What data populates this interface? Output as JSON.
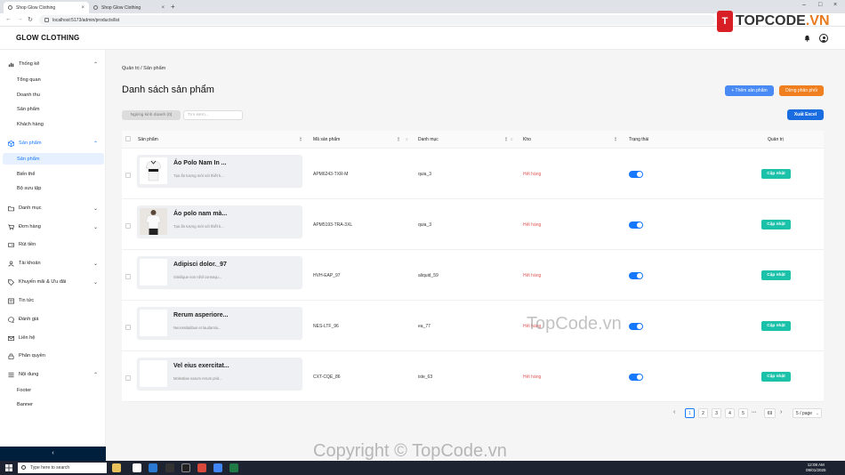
{
  "browser": {
    "tabs": [
      {
        "label": "Shop Glow Clothing",
        "active": true
      },
      {
        "label": "Shop Glow Clothing",
        "active": false
      }
    ],
    "url": "localhost:5173/admin/products/list"
  },
  "header": {
    "brand": "GLOW CLOTHING"
  },
  "sidebar": {
    "items": [
      {
        "label": "Thống kê",
        "icon": "chart-icon",
        "expanded": true
      },
      {
        "label": "Sản phẩm",
        "icon": "cube-icon",
        "expanded": true,
        "active": true
      },
      {
        "label": "Danh mục",
        "icon": "folder-icon"
      },
      {
        "label": "Đơn hàng",
        "icon": "cart-icon"
      },
      {
        "label": "Rút tiền",
        "icon": "wallet-icon"
      },
      {
        "label": "Tài khoản",
        "icon": "user-icon"
      },
      {
        "label": "Khuyến mãi & Ưu đãi",
        "icon": "tag-icon"
      },
      {
        "label": "Tin tức",
        "icon": "news-icon"
      },
      {
        "label": "Đánh giá",
        "icon": "chat-icon"
      },
      {
        "label": "Liên hệ",
        "icon": "mail-icon"
      },
      {
        "label": "Phân quyền",
        "icon": "lock-icon"
      },
      {
        "label": "Nội dung",
        "icon": "list-icon",
        "expanded": true
      }
    ],
    "thongke_sub": [
      "Tổng quan",
      "Doanh thu",
      "Sản phẩm",
      "Khách hàng"
    ],
    "sanpham_sub": [
      "Sản phẩm",
      "Biến thể",
      "Bộ sưu tập"
    ],
    "noidung_sub": [
      "Footer",
      "Banner"
    ],
    "collapse": "‹"
  },
  "main": {
    "breadcrumb": "Quản trị / Sản phẩm",
    "title": "Danh sách sản phẩm",
    "add_button": "+ Thêm sản phẩm",
    "stop_button": "Dừng phân phối",
    "excel_button": "Xuất Excel",
    "filter_tag": "Ngừng kinh doanh (0)",
    "search_placeholder": "Tìm kiếm..."
  },
  "table": {
    "columns": [
      "Sản phẩm",
      "Mã sản phẩm",
      "Danh mục",
      "Kho",
      "Trạng thái",
      "Quản trị"
    ],
    "rows": [
      {
        "name": "Áo Polo Nam In ...",
        "desc": "Tạo ấn tượng mới với thiết k...",
        "sku": "APM6243-TXR-M",
        "category": "quia_3",
        "stock": "Hết hàng",
        "status": true,
        "action": "Cập nhật"
      },
      {
        "name": "Áo polo nam mà...",
        "desc": "Tạo ấn tượng mới với thiết k...",
        "sku": "APM5193-TRA-3XL",
        "category": "quia_3",
        "stock": "Hết hàng",
        "status": true,
        "action": "Cập nhật"
      },
      {
        "name": "Adipisci dolor._97",
        "desc": "Similique non nihil consequ...",
        "sku": "HVH-EAP_97",
        "category": "aliquid_59",
        "stock": "Hết hàng",
        "status": true,
        "action": "Cập nhật"
      },
      {
        "name": "Rerum asperiore...",
        "desc": "Necessitatibus et laudantiu...",
        "sku": "NES-LTF_96",
        "category": "ea_77",
        "stock": "Hết hàng",
        "status": true,
        "action": "Cập nhật"
      },
      {
        "name": "Vel eius exercitat...",
        "desc": "Molestiae earum rerum prid...",
        "sku": "CXT-CQE_86",
        "category": "iste_63",
        "stock": "Hết hàng",
        "status": true,
        "action": "Cập nhật"
      }
    ]
  },
  "pagination": {
    "pages": [
      "1",
      "2",
      "3",
      "4",
      "5"
    ],
    "last": "69",
    "current": "1",
    "ellipsis": "•••",
    "page_size": "5 / page"
  },
  "taskbar": {
    "search_placeholder": "Type here to search",
    "time": "12:08 AM",
    "date": "09/01/2025"
  },
  "watermarks": {
    "logo_text_a": "TOPCODE",
    "logo_text_b": ".VN",
    "logo_badge": "T",
    "middle": "TopCode.vn",
    "bottom": "Copyright © TopCode.vn"
  },
  "colors": {
    "primary": "#1677ff",
    "update": "#1cc1a9",
    "stop": "#f07f1f",
    "stock_out": "#e05656",
    "sidebar_footer": "#001f3d"
  }
}
